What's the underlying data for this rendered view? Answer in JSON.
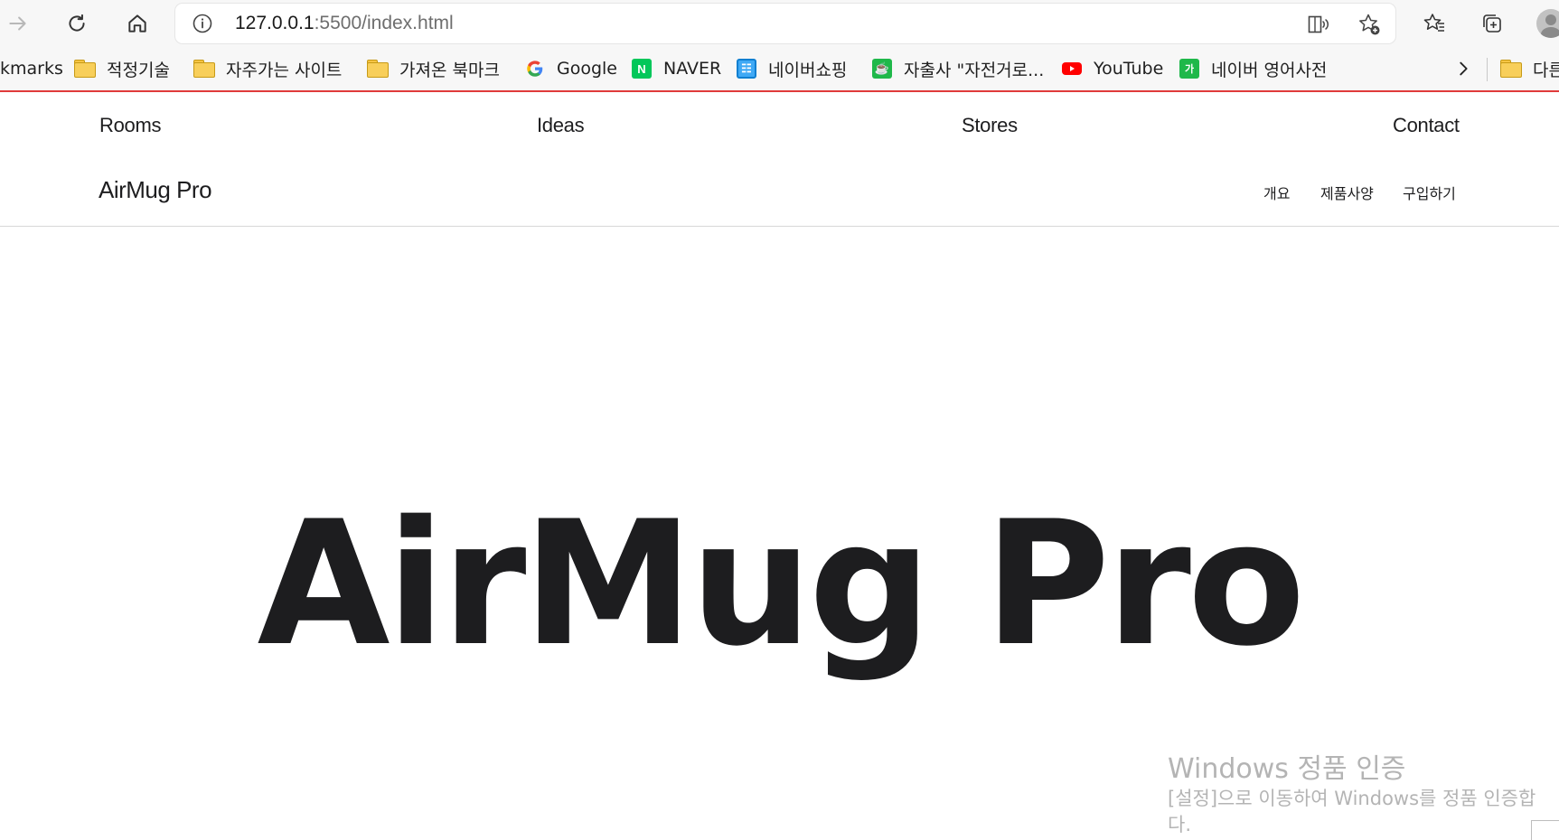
{
  "browser": {
    "url_host": "127.0.0.1",
    "url_rest": ":5500/index.html",
    "colors": {
      "toolbar_bg": "#f7f7f7",
      "active_underline": "#e03a3a"
    }
  },
  "bookmarks": {
    "partial_left": "kmarks",
    "items": [
      {
        "label": "적정기술",
        "icon": "folder-icon"
      },
      {
        "label": "자주가는 사이트",
        "icon": "folder-icon"
      },
      {
        "label": "가져온 북마크",
        "icon": "folder-icon"
      },
      {
        "label": "Google",
        "icon": "google-icon"
      },
      {
        "label": "NAVER",
        "icon": "naver-icon"
      },
      {
        "label": "네이버쇼핑",
        "icon": "naver-shopping-icon"
      },
      {
        "label": "자출사 \"자전거로...",
        "icon": "cafe-icon"
      },
      {
        "label": "YouTube",
        "icon": "youtube-icon"
      },
      {
        "label": "네이버 영어사전",
        "icon": "naver-dict-icon"
      }
    ],
    "other_partial": "다른"
  },
  "nav": {
    "items": [
      "Rooms",
      "Ideas",
      "Stores",
      "Contact"
    ]
  },
  "product_nav": {
    "title": "AirMug Pro",
    "links": [
      "개요",
      "제품사양",
      "구입하기"
    ]
  },
  "hero": {
    "title": "AirMug Pro"
  },
  "watermark": {
    "line1": "Windows 정품 인증",
    "line2": "[설정]으로 이동하여 Windows를 정품 인증합",
    "line3": "다."
  }
}
